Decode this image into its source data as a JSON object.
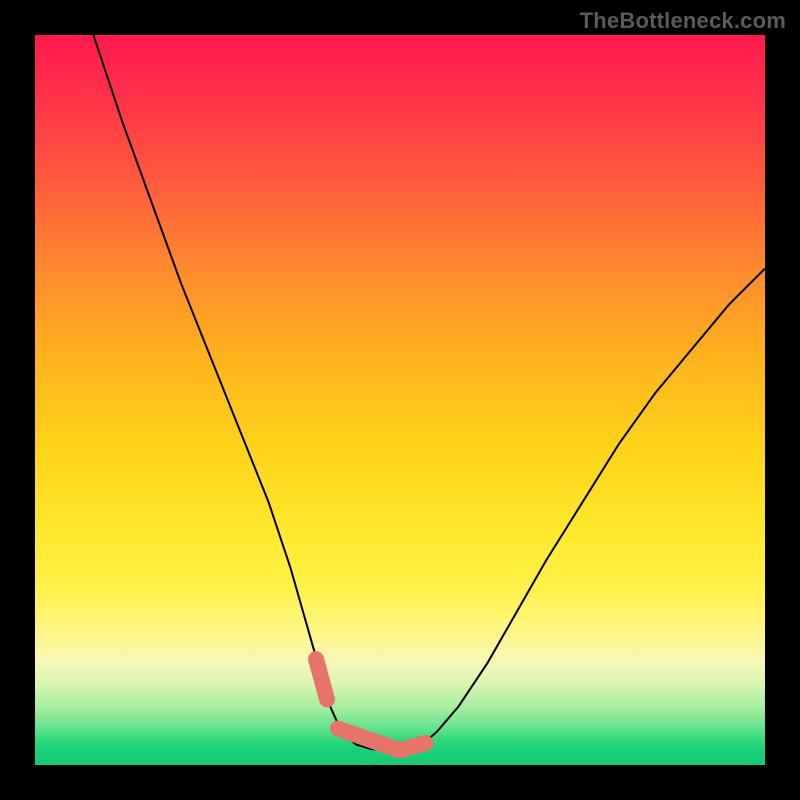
{
  "watermark": "TheBottleneck.com",
  "chart_data": {
    "type": "line",
    "title": "",
    "xlabel": "",
    "ylabel": "",
    "xlim": [
      0,
      100
    ],
    "ylim": [
      0,
      100
    ],
    "series": [
      {
        "name": "curve",
        "x": [
          8,
          12,
          16,
          20,
          24,
          28,
          32,
          35,
          37,
          39,
          40,
          42,
          44,
          46,
          48,
          50,
          51,
          53,
          55,
          58,
          62,
          66,
          70,
          75,
          80,
          85,
          90,
          95,
          100
        ],
        "values": [
          100,
          88,
          77,
          66,
          56,
          46,
          36,
          27,
          20,
          13,
          9,
          4.5,
          2.8,
          2.2,
          2.0,
          2.0,
          2.2,
          2.8,
          4.5,
          8,
          14,
          21,
          28,
          36,
          44,
          51,
          57,
          63,
          68
        ]
      }
    ],
    "highlight_segments": [
      {
        "x": [
          38.5,
          40.0
        ],
        "values": [
          14.5,
          9.0
        ]
      },
      {
        "x": [
          41.5,
          50.0
        ],
        "values": [
          5.0,
          2.0
        ]
      },
      {
        "x": [
          50.5,
          53.5
        ],
        "values": [
          2.2,
          3.0
        ]
      }
    ],
    "colors": {
      "curve": "#000000",
      "highlight": "#e7746b"
    }
  }
}
